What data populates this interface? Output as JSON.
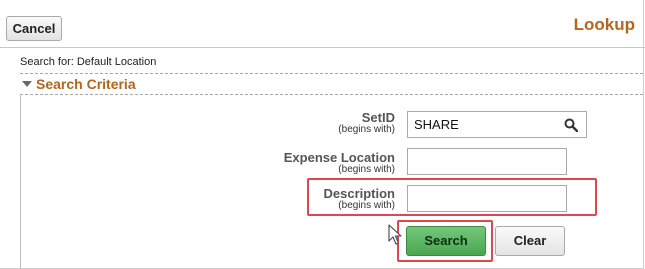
{
  "header": {
    "cancel_label": "Cancel",
    "title": "Lookup"
  },
  "search_for": {
    "text": "Search for:  Default Location"
  },
  "criteria": {
    "label": "Search Criteria"
  },
  "fields": [
    {
      "label": "SetID",
      "hint": "(begins with)",
      "value": "SHARE"
    },
    {
      "label": "Expense Location",
      "hint": "(begins with)",
      "value": ""
    },
    {
      "label": "Description",
      "hint": "(begins with)",
      "value": ""
    }
  ],
  "actions": {
    "search_label": "Search",
    "clear_label": "Clear"
  },
  "colors": {
    "title_accent": "#b5651d",
    "highlight": "#e0474c",
    "search_button": "#4aa651"
  },
  "icons": {
    "setid_lookup": "magnifier-icon",
    "criteria_toggle": "triangle-down-icon",
    "pointer": "mouse-cursor-icon"
  }
}
